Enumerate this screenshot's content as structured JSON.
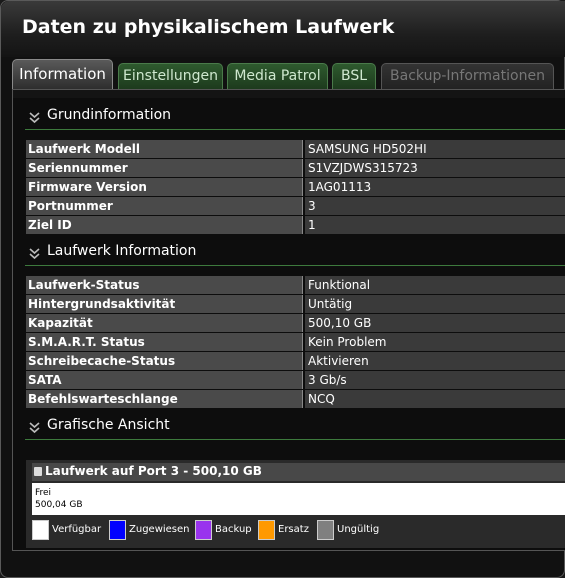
{
  "window": {
    "title": "Daten zu physikalischem Laufwerk"
  },
  "tabs": [
    {
      "label": "Information",
      "state": "active"
    },
    {
      "label": "Einstellungen",
      "state": "normal"
    },
    {
      "label": "Media Patrol",
      "state": "normal"
    },
    {
      "label": "BSL",
      "state": "normal"
    },
    {
      "label": "Backup-Informationen",
      "state": "disabled"
    }
  ],
  "sections": {
    "basic": {
      "title": "Grundinformation",
      "rows": [
        {
          "key": "Laufwerk Modell",
          "value": "SAMSUNG HD502HI"
        },
        {
          "key": "Seriennummer",
          "value": "S1VZJDWS315723"
        },
        {
          "key": "Firmware Version",
          "value": "1AG01113"
        },
        {
          "key": "Portnummer",
          "value": "3"
        },
        {
          "key": "Ziel ID",
          "value": "1"
        }
      ]
    },
    "drive": {
      "title": "Laufwerk Information",
      "rows": [
        {
          "key": "Laufwerk-Status",
          "value": "Funktional"
        },
        {
          "key": "Hintergrundsaktivität",
          "value": "Untätig"
        },
        {
          "key": "Kapazität",
          "value": "500,10 GB"
        },
        {
          "key": "S.M.A.R.T. Status",
          "value": "Kein Problem"
        },
        {
          "key": "Schreibecache-Status",
          "value": "Aktivieren"
        },
        {
          "key": "SATA",
          "value": "3 Gb/s"
        },
        {
          "key": "Befehlswarteschlange",
          "value": "NCQ"
        }
      ]
    },
    "graph": {
      "title": "Grafische Ansicht",
      "drive_label": "Laufwerk auf Port 3 - 500,10 GB",
      "segments": [
        {
          "name": "Frei",
          "size": "500,04 GB",
          "fraction": 1.0,
          "color": "#ffffff"
        }
      ],
      "legend": [
        {
          "label": "Verfügbar",
          "color": "#ffffff"
        },
        {
          "label": "Zugewiesen",
          "color": "#0000ff"
        },
        {
          "label": "Backup",
          "color": "#9933ee"
        },
        {
          "label": "Ersatz",
          "color": "#ff9900"
        },
        {
          "label": "Ungültig",
          "color": "#808080"
        }
      ]
    }
  }
}
